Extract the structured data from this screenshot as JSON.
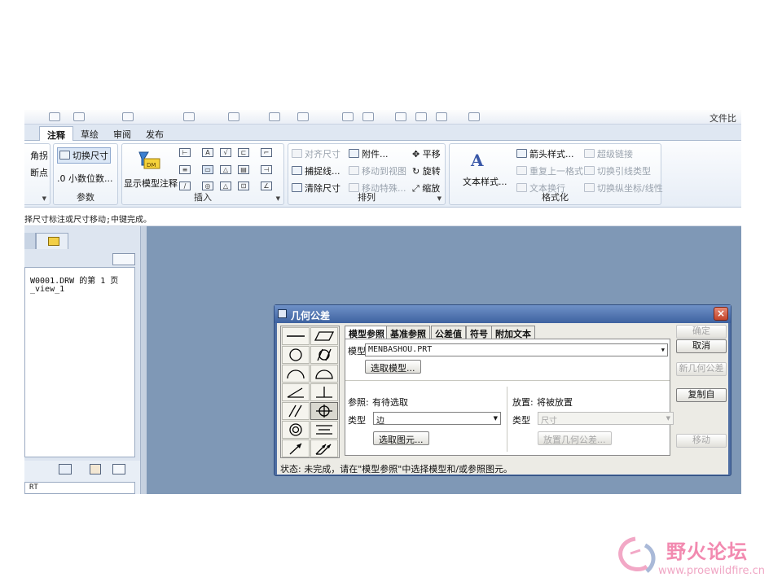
{
  "quick_access": {
    "right_text": "文件比"
  },
  "tabs": [
    {
      "label": "注释",
      "active": true
    },
    {
      "label": "草绘",
      "active": false
    },
    {
      "label": "审阅",
      "active": false
    },
    {
      "label": "发布",
      "active": false
    }
  ],
  "ribbon": {
    "partial": {
      "top": "角拐",
      "mid": "断点"
    },
    "params": {
      "label": "参数",
      "toggle_dims": "切换尺寸",
      "decimals": ".0 小数位数..."
    },
    "insert": {
      "label": "插入",
      "show_model_annotations": "显示模型注释",
      "dm_icon": "DM"
    },
    "arrange": {
      "label": "排列",
      "align_dims": "对齐尺寸",
      "attach": "附件...",
      "translate": "平移",
      "snap_line": "捕捉线...",
      "move_to_view": "移动到视图",
      "rotate": "旋转",
      "clean_dims": "清除尺寸",
      "move_special": "移动特殊...",
      "scale": "缩放"
    },
    "format": {
      "label": "格式化",
      "text_style": "文本样式...",
      "arrow_style": "箭头样式...",
      "repeat_format": "重复上一格式",
      "text_wrap": "文本换行",
      "hyperlink": "超级链接",
      "toggle_leader": "切换引线类型",
      "toggle_ordinate": "切换纵坐标/线性"
    }
  },
  "hint": "择尺寸标注或尺寸移动;中键完成。",
  "left_panel": {
    "tree": [
      "W0001.DRW 的第 1 页",
      "_view_1"
    ],
    "bottom_item": "RT"
  },
  "dialog": {
    "title": "几何公差",
    "close": "×",
    "tabs": [
      "模型参照",
      "基准参照",
      "公差值",
      "符号",
      "附加文本"
    ],
    "model_label": "模型",
    "model_value": "MENBASHOU.PRT",
    "select_model": "选取模型...",
    "ref_label": "参照:",
    "ref_value": "有待选取",
    "type_label": "类型",
    "type_value": "边",
    "select_entity": "选取图元...",
    "place_label": "放置:",
    "place_value": "将被放置",
    "place_type_label": "类型",
    "place_type_value": "尺寸",
    "place_gtol": "放置几何公差...",
    "side_buttons": {
      "ok": "确定",
      "cancel": "取消",
      "new_gtol": "新几何公差",
      "copy_from": "复制自",
      "move": "移动"
    },
    "status": "状态: 未完成，请在\"模型参照\"中选择模型和/或参照图元。"
  },
  "watermark": {
    "name": "野火论坛",
    "url": "www.proewildfire.cn"
  },
  "colors": {
    "canvas": "#7f98b6",
    "dialog_title": "#4e6ea3",
    "close_red": "#c4452b",
    "watermark": "#f28ab0"
  }
}
